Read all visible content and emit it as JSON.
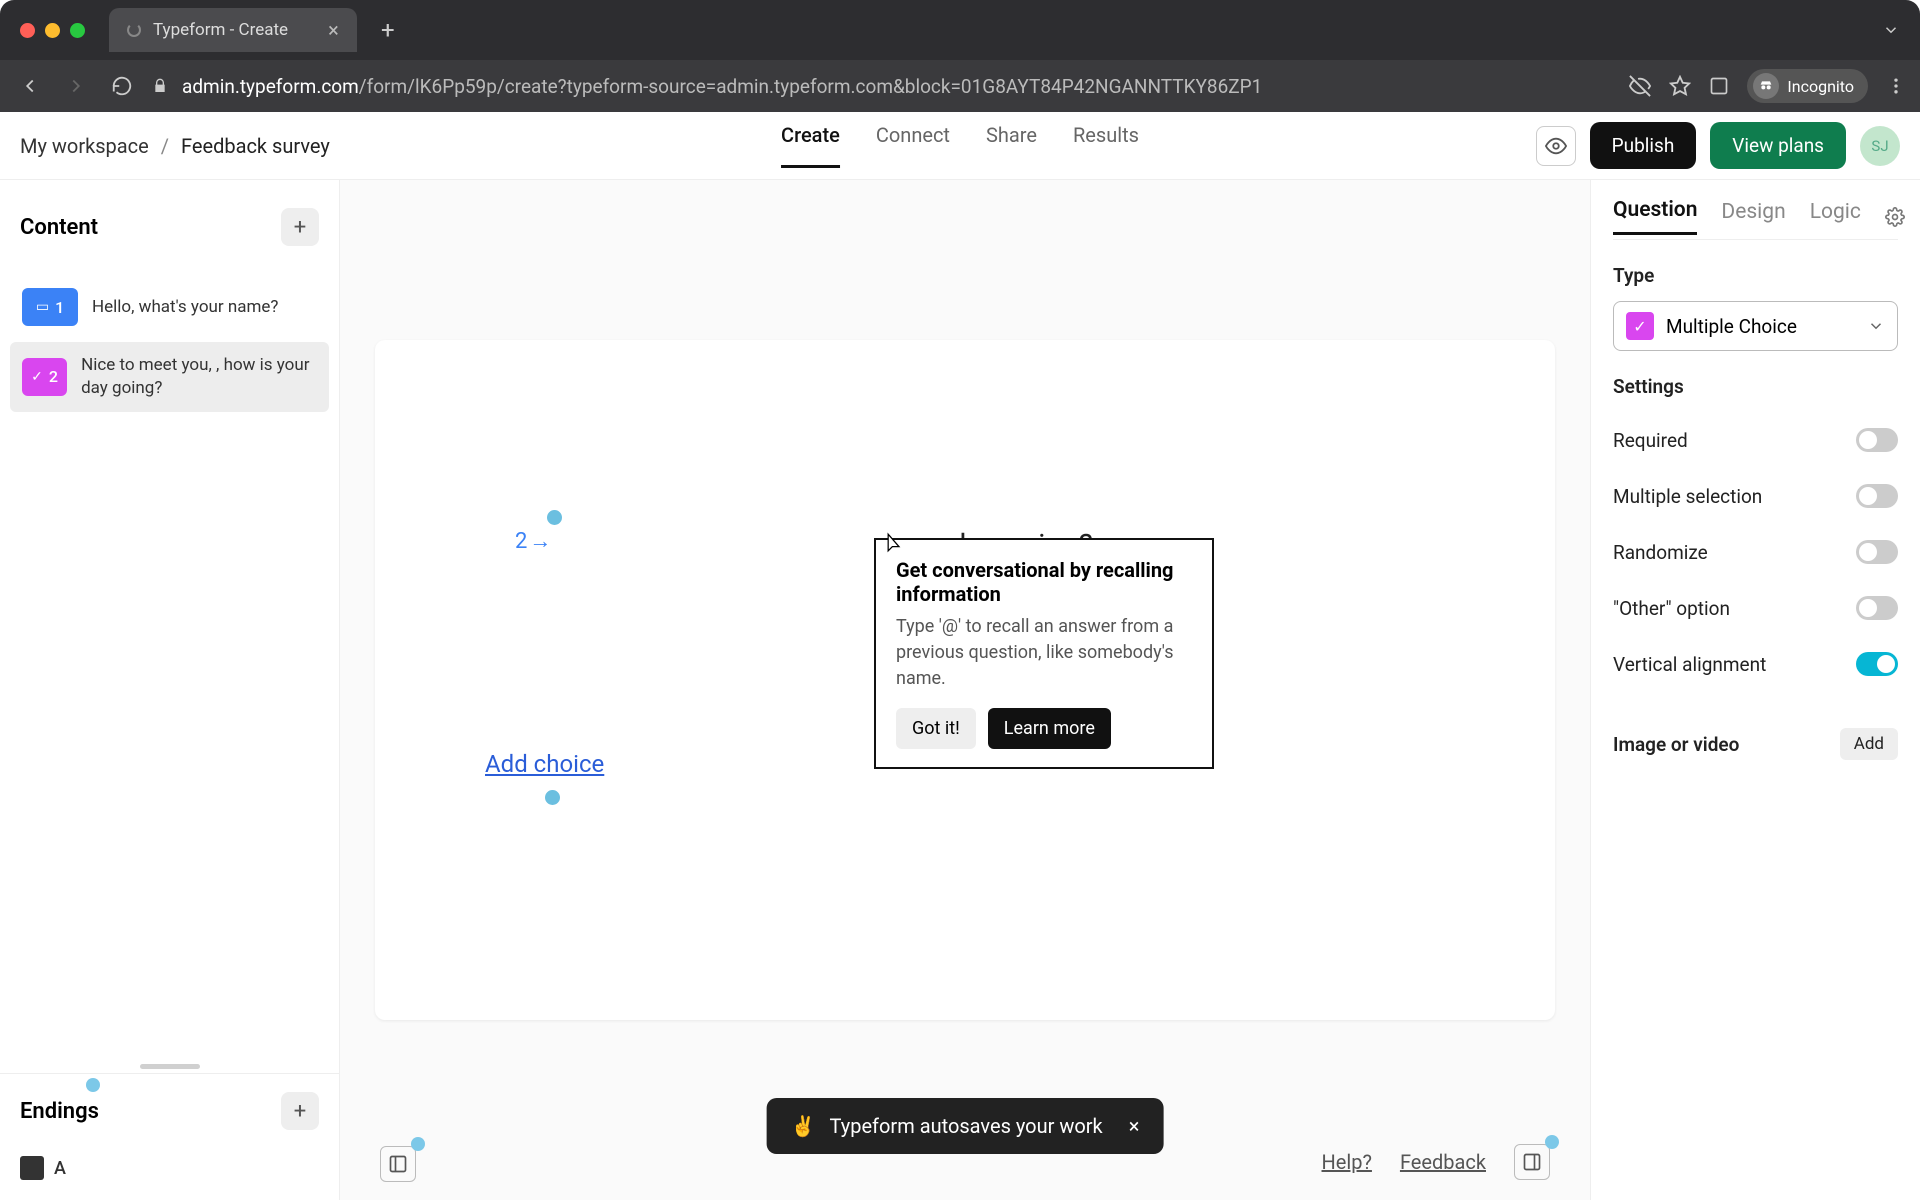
{
  "browser": {
    "tab_title": "Typeform - Create",
    "url_host": "admin.typeform.com",
    "url_path": "/form/lK6Pp59p/create?typeform-source=admin.typeform.com&block=01G8AYT84P42NGANNTTKY86ZP1",
    "incognito_label": "Incognito"
  },
  "breadcrumb": {
    "workspace": "My workspace",
    "separator": "/",
    "form_name": "Feedback survey"
  },
  "nav": {
    "create": "Create",
    "connect": "Connect",
    "share": "Share",
    "results": "Results"
  },
  "header": {
    "publish": "Publish",
    "view_plans": "View plans",
    "avatar_initials": "SJ"
  },
  "sidebar": {
    "content_title": "Content",
    "endings_title": "Endings",
    "ending_label": "A",
    "questions": [
      {
        "num": "1",
        "label": "Hello, what's your name?",
        "icon": "blue"
      },
      {
        "num": "2",
        "label": "Nice to meet you, , how is your day going?",
        "icon": "pink"
      }
    ]
  },
  "canvas": {
    "question_number": "2",
    "question_arrow": "→",
    "question_text_visible_suffix": "ur day going?",
    "add_choice": "Add choice"
  },
  "tooltip": {
    "title": "Get conversational by recalling information",
    "body": "Type '@' to recall an answer from a previous question, like somebody's name.",
    "got_it": "Got it!",
    "learn_more": "Learn more"
  },
  "toast": {
    "emoji": "✌️",
    "text": "Typeform autosaves your work"
  },
  "footer": {
    "help": "Help?",
    "feedback": "Feedback"
  },
  "right_panel": {
    "tabs": {
      "question": "Question",
      "design": "Design",
      "logic": "Logic"
    },
    "type_heading": "Type",
    "type_value": "Multiple Choice",
    "settings_heading": "Settings",
    "settings": {
      "required": "Required",
      "multiple_selection": "Multiple selection",
      "randomize": "Randomize",
      "other_option": "\"Other\" option",
      "vertical_alignment": "Vertical alignment"
    },
    "toggles": {
      "required": false,
      "multiple_selection": false,
      "randomize": false,
      "other_option": false,
      "vertical_alignment": true
    },
    "image_or_video": "Image or video",
    "add_label": "Add"
  }
}
